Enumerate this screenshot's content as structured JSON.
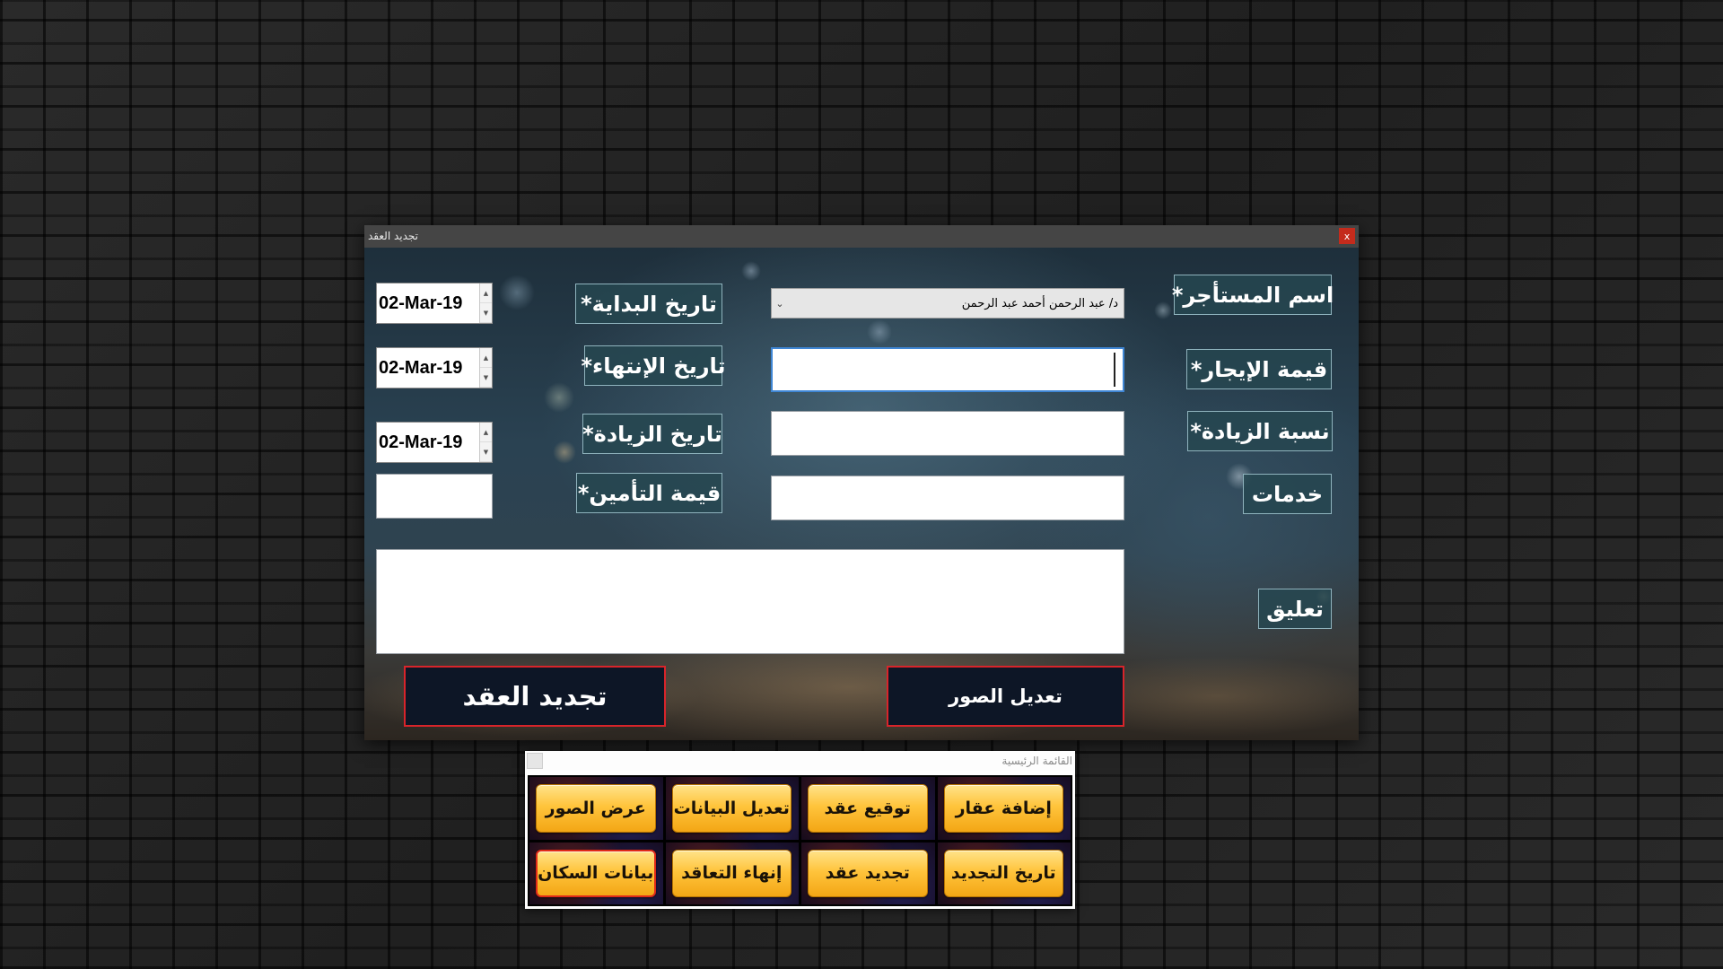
{
  "renew_window": {
    "title": "تجديد العقد",
    "close_label": "x",
    "labels": {
      "tenant_name": "اسم المستأجر*",
      "rent_value": "قيمة الإيجار*",
      "increase_rate": "نسبة الزيادة*",
      "services": "خدمات",
      "comment": "تعليق",
      "start_date": "تاريخ البداية*",
      "end_date": "تاريخ الإنتهاء*",
      "increase_date": "تاريخ الزيادة*",
      "insurance_value": "قيمة التأمين*"
    },
    "fields": {
      "tenant_name_value": "د/ عبد الرحمن أحمد عبد الرحمن",
      "tenant_dropdown_arrow": "⌄",
      "rent_value": "",
      "increase_rate": "",
      "services": "",
      "insurance_value": "",
      "comment": "",
      "start_date": "02-Mar-19",
      "end_date": "02-Mar-19",
      "increase_date": "02-Mar-19",
      "spin_up": "▲",
      "spin_down": "▼"
    },
    "buttons": {
      "edit_images": "تعديل الصور",
      "renew_contract": "تجديد العقد"
    }
  },
  "main_menu": {
    "title": "القائمة الرئيسية",
    "buttons": [
      [
        "إضافة عقار",
        "توقيع عقد",
        "تعديل البيانات",
        "عرض الصور"
      ],
      [
        "تاريخ التجديد",
        "تجديد عقد",
        "إنهاء التعاقد",
        "بيانات السكان"
      ]
    ],
    "selected": "بيانات السكان"
  },
  "colors": {
    "label_bg": "#26464f",
    "button_border": "#d8242a",
    "menu_button": "#ffc43c"
  }
}
